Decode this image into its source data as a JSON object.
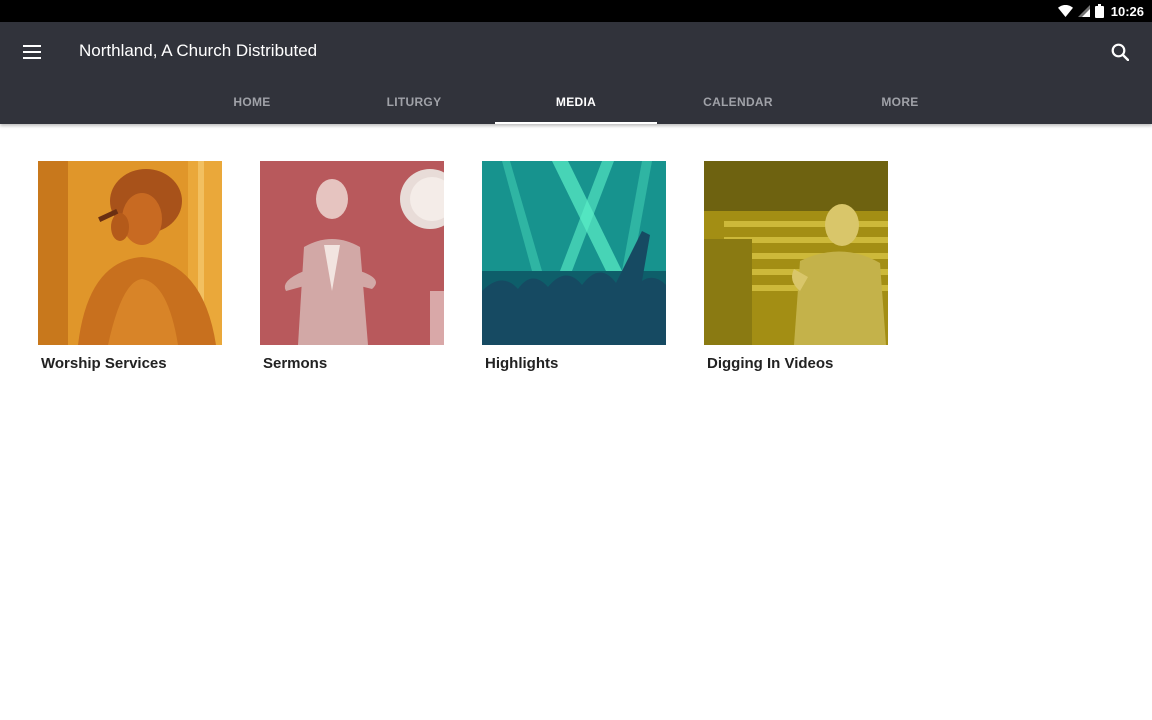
{
  "status_bar": {
    "time": "10:26",
    "icons": [
      "wifi-icon",
      "cell-signal-icon",
      "battery-icon"
    ]
  },
  "app_bar": {
    "title": "Northland, A Church Distributed",
    "menu_icon": "hamburger-menu-icon",
    "search_icon": "search-icon",
    "background": "#31333b"
  },
  "tabs": [
    {
      "label": "HOME",
      "active": false
    },
    {
      "label": "LITURGY",
      "active": false
    },
    {
      "label": "MEDIA",
      "active": true
    },
    {
      "label": "CALENDAR",
      "active": false
    },
    {
      "label": "MORE",
      "active": false
    }
  ],
  "media_items": [
    {
      "label": "Worship Services",
      "tint": "#e0962a"
    },
    {
      "label": "Sermons",
      "tint": "#c46a6e"
    },
    {
      "label": "Highlights",
      "tint": "#1fa7a0"
    },
    {
      "label": "Digging In Videos",
      "tint": "#8f7e10"
    }
  ]
}
